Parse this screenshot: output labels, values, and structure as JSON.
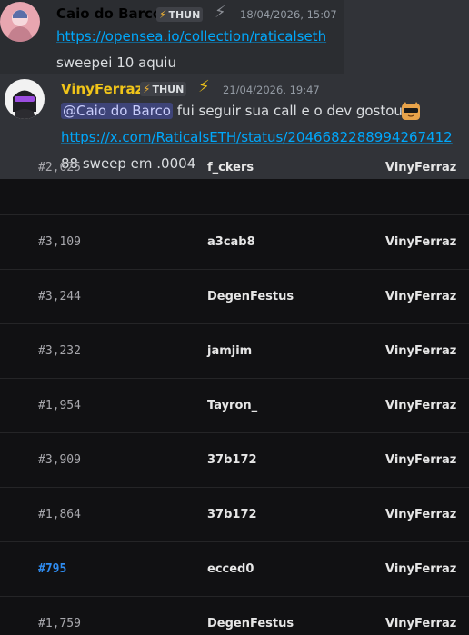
{
  "messages": [
    {
      "author": "Caio do Barco",
      "tag": "THUN",
      "timestamp": "18/04/2026, 15:07",
      "link": "https://opensea.io/collection/raticalseth",
      "text": "sweepei 10 aquiu"
    },
    {
      "author": "VinyFerraz",
      "tag": "THUN",
      "timestamp": "21/04/2026, 19:47",
      "mention": "@Caio do Barco",
      "text_after_mention": "fui seguir sua call e o dev gostou",
      "link": "https://x.com/RaticalsETH/status/2046682288994267412",
      "text": "88 sweep em .0004"
    }
  ],
  "colors": {
    "author1": "#f2f3f5",
    "author2": "#f0c419",
    "link": "#00a8fc",
    "id_highlight": "#2f8cf0"
  },
  "icons": {
    "tag_icon": "lightning-bolt",
    "badge_icon": "lightning-bolt",
    "emoji": "cat-sunglasses-emoji"
  },
  "table": {
    "rows": [
      {
        "id": "#2,625",
        "seller": "f_ckers",
        "buyer": "VinyFerraz"
      },
      {
        "id": "#3,109",
        "seller": "a3cab8",
        "buyer": "VinyFerraz"
      },
      {
        "id": "#3,244",
        "seller": "DegenFestus",
        "buyer": "VinyFerraz"
      },
      {
        "id": "#3,232",
        "seller": "jamjim",
        "buyer": "VinyFerraz"
      },
      {
        "id": "#1,954",
        "seller": "Tayron_",
        "buyer": "VinyFerraz"
      },
      {
        "id": "#3,909",
        "seller": "37b172",
        "buyer": "VinyFerraz"
      },
      {
        "id": "#1,864",
        "seller": "37b172",
        "buyer": "VinyFerraz"
      },
      {
        "id": "#795",
        "seller": "ecced0",
        "buyer": "VinyFerraz",
        "highlight": true
      },
      {
        "id": "#1,759",
        "seller": "DegenFestus",
        "buyer": "VinyFerraz"
      }
    ]
  }
}
